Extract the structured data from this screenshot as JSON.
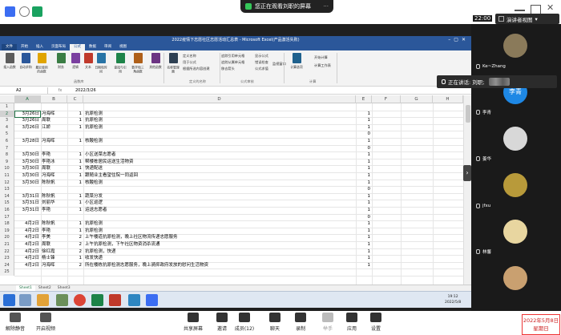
{
  "top": {
    "share_status": "您正在观看刘职的屏幕",
    "clock": "22:00",
    "presenter_view": "演讲者视图"
  },
  "excel": {
    "title": "2022疫情下志愿社区志愿活动汇总表 - Microsoft Excel(产品激活失败)",
    "tabs": [
      "文件",
      "开始",
      "插入",
      "页面布局",
      "公式",
      "数据",
      "审阅",
      "视图"
    ],
    "active_tab": "公式",
    "ribbon_buttons": [
      "插入函数",
      "自动求和",
      "最近使用的函数",
      "财务",
      "逻辑",
      "文本",
      "日期和时间",
      "查找与引用",
      "数学和三角函数",
      "其他函数",
      "名称管理器",
      "计算选项"
    ],
    "ribbon_small": [
      "定义名称",
      "用于公式",
      "根据所选内容创建",
      "追踪引用单元格",
      "追踪从属单元格",
      "移去箭头",
      "显示公式",
      "错误检查",
      "公式求值",
      "监视窗口",
      "开始计算",
      "计算工作表"
    ],
    "groups": [
      "函数库",
      "定义的名称",
      "公式审核",
      "计算"
    ],
    "name_box": "A2",
    "formula_value": "2022/3/26",
    "columns": [
      "A",
      "B",
      "C",
      "D",
      "E",
      "F",
      "G",
      "H"
    ],
    "rows": [
      {
        "n": "1",
        "a": "",
        "b": "",
        "c": "",
        "d": "",
        "e": ""
      },
      {
        "n": "2",
        "a": "3月26日",
        "b": "冯海晖",
        "c": "1",
        "d": "抗原检测",
        "e": "1"
      },
      {
        "n": "3",
        "a": "3月26日",
        "b": "周联",
        "c": "1",
        "d": "抗原检测",
        "e": "1"
      },
      {
        "n": "4",
        "a": "3月26日",
        "b": "江娇",
        "c": "1",
        "d": "抗原检测",
        "e": "1"
      },
      {
        "n": "5",
        "a": "",
        "b": "",
        "c": "",
        "d": "",
        "e": "0"
      },
      {
        "n": "6",
        "a": "3月28日",
        "b": "冯海晖",
        "c": "1",
        "d": "核酸检测",
        "e": "1"
      },
      {
        "n": "7",
        "a": "",
        "b": "",
        "c": "",
        "d": "",
        "e": "0"
      },
      {
        "n": "8",
        "a": "3月30日",
        "b": "李艳",
        "c": "1",
        "d": "小区送菜志愿者",
        "e": "1"
      },
      {
        "n": "9",
        "a": "3月30日",
        "b": "李艳冰",
        "c": "1",
        "d": "帮楼栋居民运送生活物资",
        "e": "1"
      },
      {
        "n": "10",
        "a": "3月30日",
        "b": "周联",
        "c": "1",
        "d": "快递配送",
        "e": "1"
      },
      {
        "n": "11",
        "a": "3月30日",
        "b": "冯海晖",
        "c": "1",
        "d": "跟随业主看望住院一同返回",
        "e": "1"
      },
      {
        "n": "12",
        "a": "3月30日",
        "b": "陈秋帆",
        "c": "1",
        "d": "核酸检测",
        "e": "1"
      },
      {
        "n": "13",
        "a": "",
        "b": "",
        "c": "",
        "d": "",
        "e": "0"
      },
      {
        "n": "14",
        "a": "3月31日",
        "b": "陈秋帆",
        "c": "1",
        "d": "蔬菜分发",
        "e": "1"
      },
      {
        "n": "15",
        "a": "3月31日",
        "b": "刘丽华",
        "c": "1",
        "d": "小区巡逻",
        "e": "1"
      },
      {
        "n": "16",
        "a": "3月31日",
        "b": "李艳",
        "c": "1",
        "d": "运送志愿者",
        "e": "1"
      },
      {
        "n": "17",
        "a": "",
        "b": "",
        "c": "",
        "d": "",
        "e": "0"
      },
      {
        "n": "18",
        "a": "4月2日",
        "b": "陈秋帆",
        "c": "1",
        "d": "抗原检测",
        "e": "1"
      },
      {
        "n": "19",
        "a": "4月2日",
        "b": "李艳",
        "c": "1",
        "d": "抗原检测",
        "e": "1"
      },
      {
        "n": "20",
        "a": "4月2日",
        "b": "李美",
        "c": "2",
        "d": "上午楼道抗原检测，晚上社区物流传递志愿服务",
        "e": "1"
      },
      {
        "n": "21",
        "a": "4月2日",
        "b": "周联",
        "c": "2",
        "d": "上午抗原检测，下午社区物资消杀流通",
        "e": "1"
      },
      {
        "n": "22",
        "a": "4月2日",
        "b": "徐红霞",
        "c": "2",
        "d": "抗原检测，快递",
        "e": "1"
      },
      {
        "n": "23",
        "a": "4月2日",
        "b": "杨士锋",
        "c": "1",
        "d": "收发快递",
        "e": "1"
      },
      {
        "n": "24",
        "a": "4月2日",
        "b": "冯海晖",
        "c": "2",
        "d": "所在楼栋抗原检测志愿服务，晚上骑抑政府发放的慰问生活物资",
        "e": "1"
      },
      {
        "n": "25",
        "a": "",
        "b": "",
        "c": "",
        "d": "",
        "e": ""
      }
    ],
    "sheets": [
      "Sheet1",
      "Sheet2",
      "Sheet3"
    ]
  },
  "taskbar": {
    "time": "19:12",
    "date": "2022/5/8"
  },
  "participants": [
    {
      "name": "Ke~Zhang",
      "avatar_text": "",
      "color": "#8a7a5a"
    },
    {
      "name": "李青",
      "avatar_text": "李青",
      "color": "#1e88e5"
    },
    {
      "name": "姜华",
      "avatar_text": "",
      "color": "#d8d8d8"
    },
    {
      "name": "jfxu",
      "avatar_text": "",
      "color": "#b89a3a"
    },
    {
      "name": "林馨",
      "avatar_text": "",
      "color": "#e8d6a0"
    },
    {
      "name": "",
      "avatar_text": "",
      "color": "#c9a070"
    }
  ],
  "speaking": {
    "label": "正在讲话: 刘职;"
  },
  "toolbar": {
    "items": [
      "解除静音",
      "开启视频",
      "共享屏幕",
      "邀请",
      "成员(12)",
      "聊天",
      "录制",
      "举手",
      "应用",
      "设置"
    ],
    "date_line1": "2022年5月8日",
    "date_line2": "星期日"
  }
}
